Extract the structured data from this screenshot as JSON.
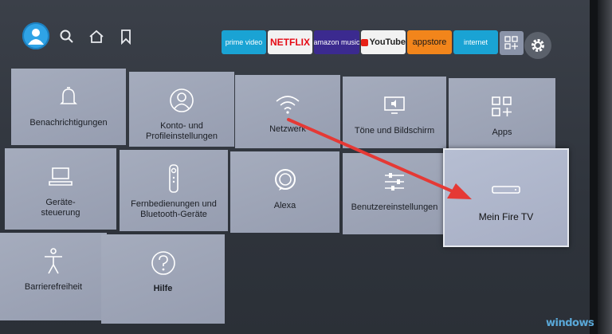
{
  "topbar": {
    "apps": [
      {
        "label": "prime video",
        "bg": "#1aa3d4",
        "color": "#ffffff"
      },
      {
        "label": "NETFLIX",
        "bg": "#f2f2f2",
        "color": "#e50914"
      },
      {
        "label": "amazon music",
        "bg": "#3b2a8f",
        "color": "#ffffff"
      },
      {
        "label": "YouTube",
        "bg": "#f2f2f2",
        "color": "#222222"
      },
      {
        "label": "appstore",
        "bg": "#f2851b",
        "color": "#1a1a1a"
      },
      {
        "label": "internet",
        "bg": "#1aa3d4",
        "color": "#ffffff"
      }
    ]
  },
  "tiles": {
    "benachrichtigungen": "Benachrichtigungen",
    "konto": "Konto- und Profileinstellungen",
    "netzwerk": "Netzwerk",
    "toene": "Töne und Bildschirm",
    "apps": "Apps",
    "geraete": "Geräte-steuerung",
    "fernbedienungen": "Fernbedienungen und Bluetooth-Geräte",
    "alexa": "Alexa",
    "benutzer": "Benutzereinstellungen",
    "meinfiretv": "Mein Fire TV",
    "barriere": "Barrierefreiheit",
    "hilfe": "Hilfe"
  },
  "colors": {
    "arrow": "#e53935",
    "accent": "#2fa3e6"
  },
  "watermark": "windows"
}
